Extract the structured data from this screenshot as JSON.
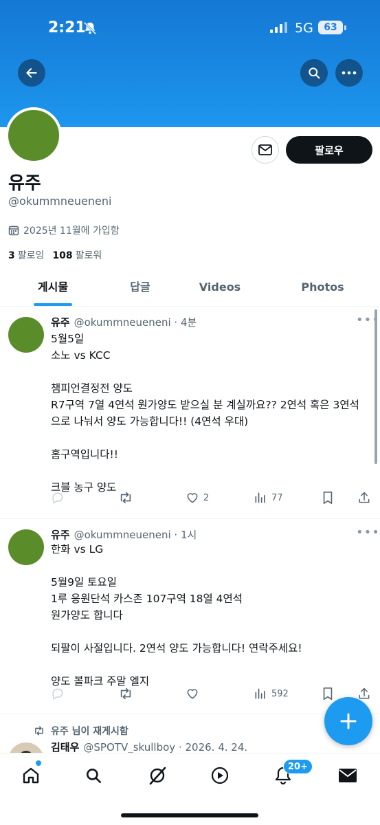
{
  "status_bar": {
    "time": "2:21",
    "network": "5G",
    "battery": "63"
  },
  "profile": {
    "display_name": "유주",
    "handle": "@okummneueneni",
    "joined": "2025년 11월에 가입함",
    "following_count": "3",
    "following_label": "팔로잉",
    "followers_count": "108",
    "followers_label": "팔로워",
    "follow_label": "팔로우"
  },
  "tabs": [
    {
      "label": "게시물",
      "active": true
    },
    {
      "label": "답글",
      "active": false
    },
    {
      "label": "Videos",
      "active": false
    },
    {
      "label": "Photos",
      "active": false
    }
  ],
  "posts": [
    {
      "name": "유주",
      "handle": "@okummneueneni",
      "time": "4분",
      "text": "5월5일\n소노 vs KCC\n\n챔피언결정전 양도\nR7구역 7열 4연석 원가양도 받으실 분 계실까요?? 2연석 혹은 3연석으로 나눠서 양도 가능합니다!! (4연석 우대)\n\n홈구역입니다!!\n\n크블 농구 양도",
      "likes": "2",
      "views": "77"
    },
    {
      "name": "유주",
      "handle": "@okummneueneni",
      "time": "1시",
      "text": "한화 vs LG\n\n5월9일 토요일\n1루 응원단석 카스존 107구역 18열 4연석\n원가양도 합니다\n\n되팔이 사절입니다. 2연석 양도 가능합니다! 연락주세요!\n\n양도 볼파크 주말 엘지",
      "likes": "",
      "views": "592"
    }
  ],
  "retweet": {
    "note": "유주 님이 재게시함",
    "name": "김태우",
    "handle": "@SPOTV_skullboy",
    "date": "2026. 4. 24."
  },
  "bottom_nav": {
    "notification_badge": "20+"
  },
  "colors": {
    "accent": "#1d9bf0",
    "banner": "#1d96ee",
    "avatar": "#5b8c2a"
  }
}
